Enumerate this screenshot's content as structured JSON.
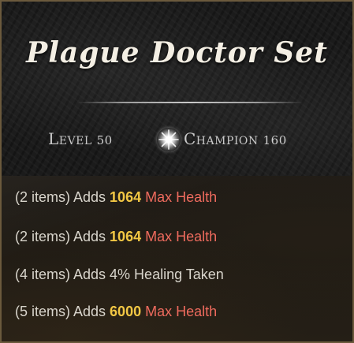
{
  "tooltip": {
    "title": "Plague Doctor Set",
    "level_label": "Level",
    "level_value": "50",
    "champion_label": "Champion",
    "champion_value": "160",
    "champion_icon": "champion-point-icon"
  },
  "bonuses": [
    {
      "prefix": "(2 items) Adds ",
      "value": "1064",
      "stat": " Max Health",
      "text": ""
    },
    {
      "prefix": "(2 items) Adds ",
      "value": "1064",
      "stat": " Max Health",
      "text": ""
    },
    {
      "prefix": "",
      "value": "",
      "stat": "",
      "text": "(4 items) Adds 4% Healing Taken"
    },
    {
      "prefix": "(5 items) Adds ",
      "value": "6000",
      "stat": " Max Health",
      "text": ""
    }
  ],
  "colors": {
    "value": "#f2c744",
    "stat": "#ef6b5e",
    "text": "#d9d5cc",
    "title": "#f4efe4",
    "border": "#6b5a3d"
  }
}
